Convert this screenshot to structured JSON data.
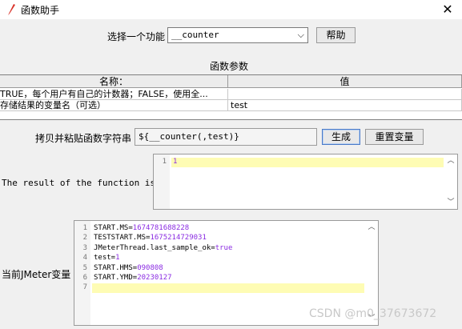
{
  "window": {
    "title": "函数助手",
    "close_glyph": "✕"
  },
  "function_select": {
    "label": "选择一个功能",
    "value": "__counter",
    "arrow": "⌵"
  },
  "help_button": "帮助",
  "params": {
    "title": "函数参数",
    "columns": [
      "名称：",
      "值"
    ],
    "rows": [
      [
        "TRUE，每个用户有自己的计数器；FALSE，使用全...",
        ""
      ],
      [
        "存储结果的变量名（可选）",
        "test"
      ]
    ]
  },
  "copy_row": {
    "label": "拷贝并粘贴函数字符串",
    "value": "${__counter(,test)}",
    "generate": "生成",
    "reset": "重置变量"
  },
  "result": {
    "label": "The result of the function is",
    "lines": [
      "1"
    ]
  },
  "vars": {
    "label": "当前JMeter变量",
    "lines": [
      {
        "key": "START.MS=",
        "val": "1674781688228"
      },
      {
        "key": "TESTSTART.MS=",
        "val": "1675214729031"
      },
      {
        "key": "JMeterThread.last_sample_ok=",
        "val": "true"
      },
      {
        "key": "test=",
        "val": "1"
      },
      {
        "key": "START.HMS=",
        "val": "090808"
      },
      {
        "key": "START.YMD=",
        "val": "20230127"
      },
      {
        "key": "",
        "val": ""
      }
    ],
    "line_numbers": [
      "1",
      "2",
      "3",
      "4",
      "5",
      "6",
      "7"
    ]
  },
  "watermark": "CSDN @m0_37673672",
  "colors": {
    "highlight": "#fefcb4",
    "value_purple": "#8a2be2"
  }
}
